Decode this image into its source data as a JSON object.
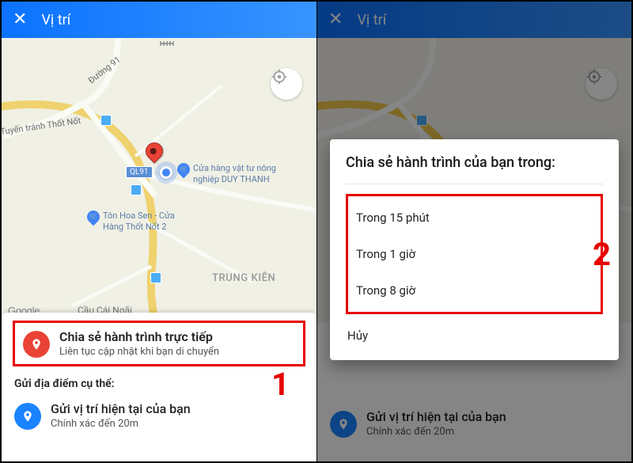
{
  "header": {
    "title": "Vị trí"
  },
  "map": {
    "street_label_1": "Đường 91",
    "bypass_label": "Tuyến tránh Thốt Nốt",
    "route_badge": "QL91",
    "poi_shop": "Cửa hàng vật tư nông\nnghiệp DUY THANH",
    "poi_ton": "Tôn Hoa Sen - Cửa\nHàng Thốt Nốt 2",
    "district": "TRUNG KIÊN",
    "bridge": "Cầu Cái Ngãi",
    "google": "Google"
  },
  "sheet1": {
    "share_live_title": "Chia sẻ hành trình trực tiếp",
    "share_live_sub": "Liên tục cập nhật khi bạn di chuyển",
    "send_specific": "Gửi địa điểm cụ thể:",
    "send_current_title": "Gửi vị trí hiện tại của bạn",
    "send_current_sub": "Chính xác đến 20m"
  },
  "dialog": {
    "title": "Chia sẻ hành trình của bạn trong:",
    "options": [
      "Trong 15 phút",
      "Trong 1 giờ",
      "Trong 8 giờ"
    ],
    "cancel": "Hủy"
  },
  "steps": {
    "one": "1",
    "two": "2"
  },
  "colors": {
    "accent_red": "#ea4335",
    "accent_blue": "#1a83ff",
    "annotation_red": "#e60000"
  }
}
